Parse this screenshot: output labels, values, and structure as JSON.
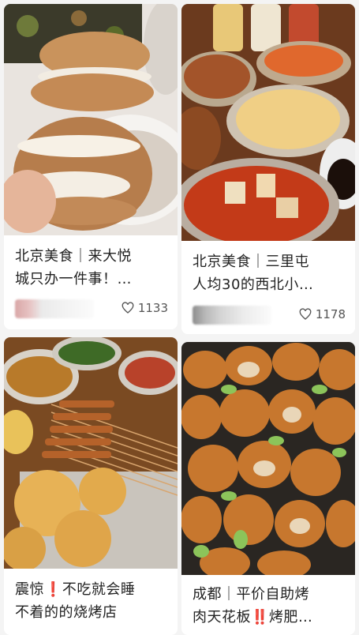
{
  "feed": {
    "cards": [
      {
        "title_line1": "北京美食｜来大悦",
        "title_line2": "城只办一件事！…",
        "likes": "1133",
        "image": "bao-sandwich"
      },
      {
        "title_line1": "北京美食｜三里屯",
        "title_line2": "人均30的西北小…",
        "likes": "1178",
        "image": "northwest-noodles"
      },
      {
        "title_line1": "震惊❗不吃就会睡",
        "title_line2": "不着的的烧烤店",
        "likes": "",
        "image": "bbq-skewers"
      },
      {
        "title_line1": "成都｜平价自助烤",
        "title_line2": "肉天花板‼️烤肥…",
        "likes": "",
        "image": "grilled-intestines"
      }
    ],
    "icons": {
      "like": "heart-outline-icon"
    }
  }
}
